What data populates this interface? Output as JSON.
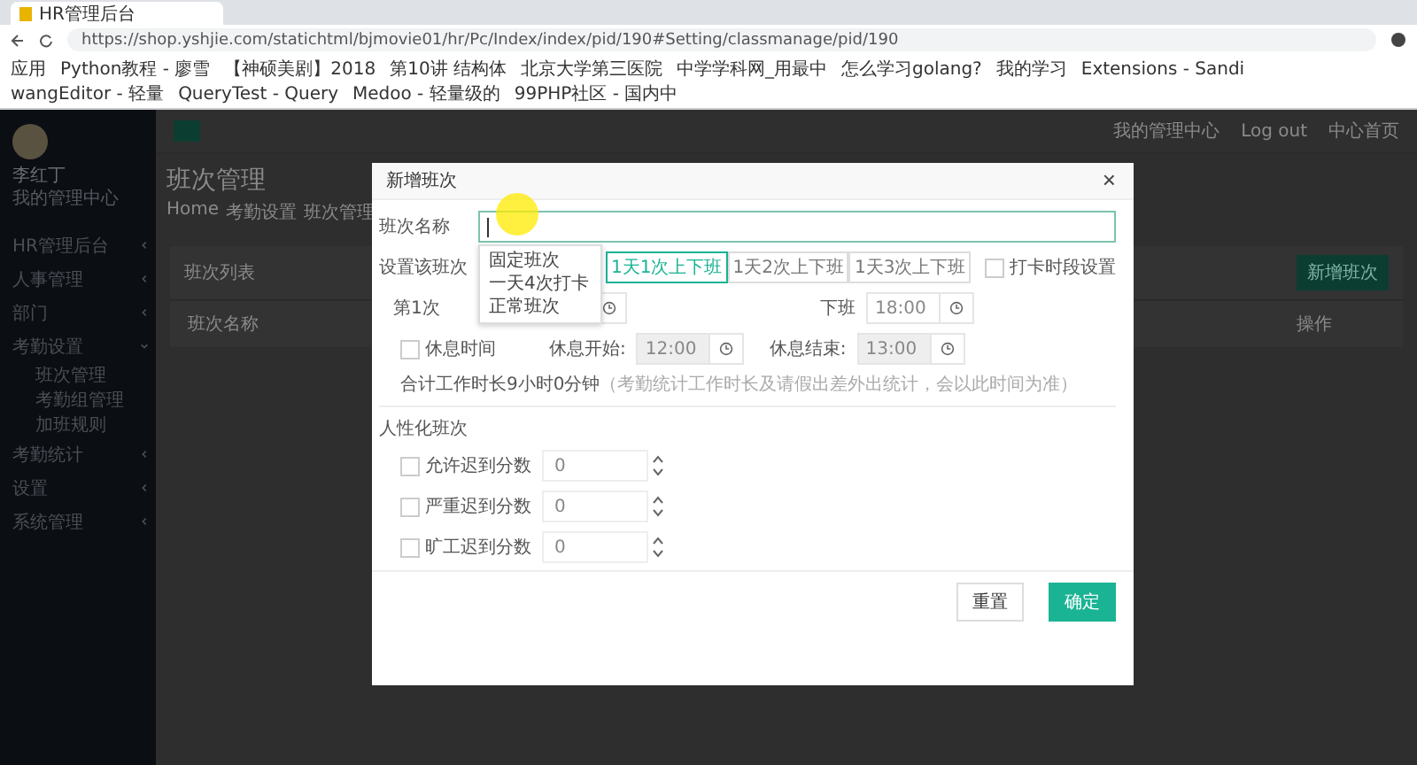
{
  "browser": {
    "tab_title": "HR管理后台",
    "url": "https://shop.yshjie.com/statichtml/bjmovie01/hr/Pc/Index/index/pid/190#Setting/classmanage/pid/190",
    "bookmarks": [
      "应用",
      "Python教程 - 廖雪",
      "【神硕美剧】2018",
      "第10讲 结构体",
      "北京大学第三医院",
      "中学学科网_用最中",
      "怎么学习golang?",
      "我的学习",
      "Extensions - Sandi",
      "wangEditor - 轻量",
      "QueryTest - Query",
      "Medoo - 轻量级的",
      "99PHP社区 - 国内中"
    ]
  },
  "sidebar": {
    "user_name": "李红丁",
    "user_role": "我的管理中心",
    "items": [
      {
        "label": "HR管理后台",
        "expanded": false
      },
      {
        "label": "人事管理",
        "expanded": false
      },
      {
        "label": "部门",
        "expanded": false
      },
      {
        "label": "考勤设置",
        "expanded": true,
        "children": [
          {
            "label": "班次管理"
          },
          {
            "label": "考勤组管理"
          },
          {
            "label": "加班规则"
          }
        ]
      },
      {
        "label": "考勤统计",
        "expanded": false
      },
      {
        "label": "设置",
        "expanded": false
      },
      {
        "label": "系统管理",
        "expanded": false
      }
    ]
  },
  "header": {
    "links": [
      "我的管理中心",
      "Log out",
      "中心首页"
    ]
  },
  "page": {
    "title": "班次管理",
    "breadcrumb": [
      "Home",
      "考勤设置",
      "班次管理"
    ],
    "panel_title": "班次列表",
    "add_button": "新增班次",
    "columns": [
      "班次名称",
      "操作"
    ]
  },
  "dialog": {
    "title": "新增班次",
    "close": "×",
    "name_field": {
      "label": "班次名称"
    },
    "suggestions": [
      "固定班次",
      "一天4次打卡",
      "正常班次"
    ],
    "shift_label": "设置该班次",
    "shift_options": [
      {
        "label": "1天1次上下班",
        "selected": true
      },
      {
        "label": "1天2次上下班",
        "selected": false
      },
      {
        "label": "1天3次上下班",
        "selected": false
      }
    ],
    "punch_setting": {
      "label": "打卡时段设置",
      "checked": false
    },
    "first_shift": {
      "label": "第1次",
      "off_label": "下班",
      "off_value": "18:00"
    },
    "rest": {
      "label": "休息时间",
      "checked": false,
      "start_label": "休息开始:",
      "start_value": "12:00",
      "end_label": "休息结束:",
      "end_value": "13:00"
    },
    "total": "合计工作时长9小时0分钟",
    "total_note": "（考勤统计工作时长及请假出差外出统计，会以此时间为准）",
    "section_title": "人性化班次",
    "rules": [
      {
        "label": "允许迟到分数",
        "checked": false,
        "value": "0"
      },
      {
        "label": "严重迟到分数",
        "checked": false,
        "value": "0"
      },
      {
        "label": "旷工迟到分数",
        "checked": false,
        "value": "0"
      }
    ],
    "buttons": [
      {
        "label": "重置",
        "kind": "plain"
      },
      {
        "label": "确定",
        "kind": "primary"
      }
    ]
  }
}
